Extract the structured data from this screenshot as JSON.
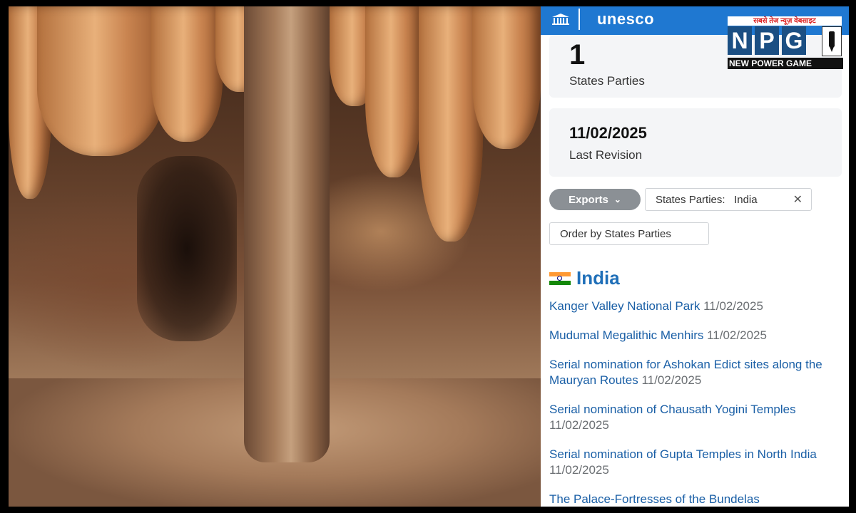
{
  "brand": {
    "unesco_text": "unesco",
    "npg_tagline": "सबसे तेज न्यूज़ वेबसाइट",
    "npg_letters": [
      "N",
      "P",
      "G"
    ],
    "npg_subtitle": "NEW POWER GAME"
  },
  "stats": {
    "states_parties_count": "1",
    "states_parties_label": "States Parties",
    "last_revision_date": "11/02/2025",
    "last_revision_label": "Last Revision"
  },
  "controls": {
    "exports_label": "Exports",
    "filter_label": "States Parties:",
    "filter_value": "India",
    "order_label": "Order by States Parties"
  },
  "country": {
    "name": "India"
  },
  "sites": [
    {
      "name": "Kanger Valley National Park",
      "date": "11/02/2025"
    },
    {
      "name": "Mudumal Megalithic Menhirs",
      "date": "11/02/2025"
    },
    {
      "name": "Serial nomination for Ashokan Edict sites along the Mauryan Routes",
      "date": "11/02/2025"
    },
    {
      "name": "Serial nomination of Chausath Yogini Temples",
      "date": "11/02/2025"
    },
    {
      "name": "Serial nomination of Gupta Temples in North India",
      "date": "11/02/2025"
    },
    {
      "name": "The Palace-Fortresses of the Bundelas",
      "date": ""
    }
  ],
  "colors": {
    "unesco_blue": "#1f78d1",
    "link_blue": "#1a5fa6",
    "exports_gray": "#8b9095"
  }
}
